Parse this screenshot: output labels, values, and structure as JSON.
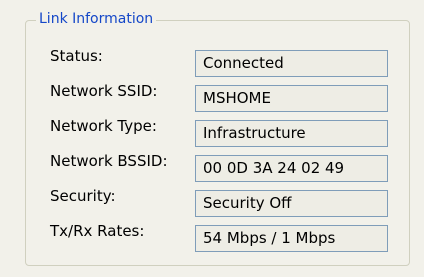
{
  "group": {
    "title": "Link Information"
  },
  "rows": [
    {
      "label": "Status:",
      "value": "Connected"
    },
    {
      "label": "Network SSID:",
      "value": "MSHOME"
    },
    {
      "label": "Network Type:",
      "value": "Infrastructure"
    },
    {
      "label": "Network BSSID:",
      "value": "00 0D 3A 24 02 49"
    },
    {
      "label": "Security:",
      "value": "Security Off"
    },
    {
      "label": "Tx/Rx Rates:",
      "value": "54 Mbps / 1 Mbps"
    }
  ]
}
